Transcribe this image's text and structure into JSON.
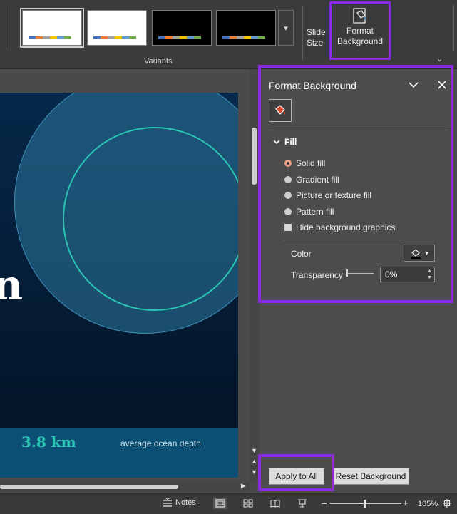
{
  "ribbon": {
    "variants_group_label": "Variants",
    "variants": [
      {
        "theme": "light",
        "selected": true
      },
      {
        "theme": "light",
        "selected": false
      },
      {
        "theme": "dark",
        "selected": false
      },
      {
        "theme": "dark",
        "selected": false
      }
    ],
    "variant_swatch_colors": [
      "#4472c4",
      "#ed7d31",
      "#a5a5a5",
      "#ffc000",
      "#5b9bd5",
      "#70ad47"
    ],
    "slide_size_label": "Slide Size",
    "format_background_label": "Format Background",
    "format_background_icon": "paint-bucket-icon"
  },
  "slide": {
    "partial_letter": "n",
    "depth_value": "3.8 km",
    "depth_label": "average ocean depth"
  },
  "pane": {
    "title": "Format Background",
    "section_fill": "Fill",
    "fill_options": [
      {
        "label": "Solid fill",
        "checked": true
      },
      {
        "label": "Gradient fill",
        "checked": false
      },
      {
        "label": "Picture or texture fill",
        "checked": false
      },
      {
        "label": "Pattern fill",
        "checked": false
      }
    ],
    "hide_graphics_label": "Hide background graphics",
    "hide_graphics_checked": false,
    "color_label": "Color",
    "transparency_label": "Transparency",
    "transparency_value": "0%",
    "apply_all_label": "Apply to All",
    "reset_label": "Reset Background"
  },
  "statusbar": {
    "notes_label": "Notes",
    "zoom_level": "105%"
  },
  "colors": {
    "highlight": "#8a2be2",
    "accent_teal": "#2bc4b2",
    "slide_bg": "#051a33"
  }
}
